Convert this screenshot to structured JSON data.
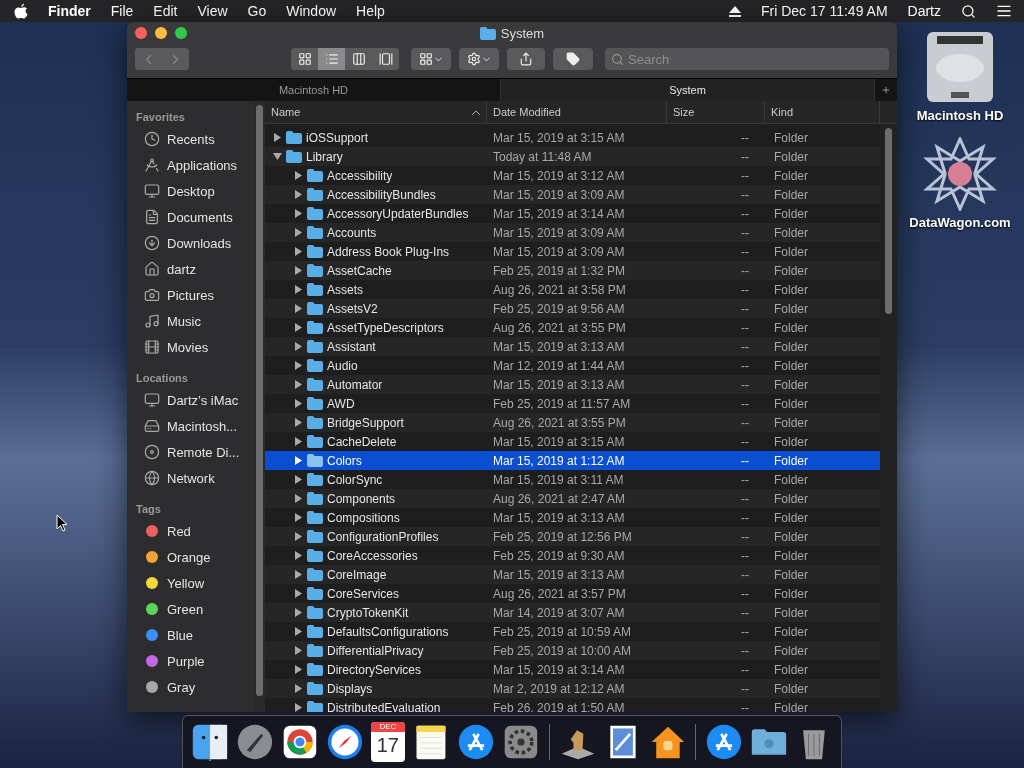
{
  "menu_bar": {
    "app": "Finder",
    "menus": [
      "File",
      "Edit",
      "View",
      "Go",
      "Window",
      "Help"
    ],
    "clock": "Fri Dec 17  11:49 AM",
    "user": "Dartz"
  },
  "window": {
    "title": "System",
    "search": {
      "placeholder": "Search"
    },
    "view_modes": [
      {
        "selected": false
      },
      {
        "selected": true
      },
      {
        "selected": false
      },
      {
        "selected": false
      }
    ],
    "tabs": [
      {
        "label": "Macintosh HD",
        "selected": false
      },
      {
        "label": "System",
        "selected": true
      }
    ],
    "sidebar": [
      {
        "heading": "Favorites",
        "items": [
          "Recents",
          "Applications",
          "Desktop",
          "Documents",
          "Downloads",
          "dartz",
          "Pictures",
          "Music",
          "Movies"
        ]
      },
      {
        "heading": "Locations",
        "items": [
          "Dartz’s iMac",
          "Macintosh...",
          "Remote Di...",
          "Network"
        ]
      },
      {
        "heading": "Tags",
        "tags": [
          {
            "label": "Red",
            "color": "#ec5f5e"
          },
          {
            "label": "Orange",
            "color": "#f6a33a"
          },
          {
            "label": "Yellow",
            "color": "#f4d83b"
          },
          {
            "label": "Green",
            "color": "#5dd55a"
          },
          {
            "label": "Blue",
            "color": "#3a8ef6"
          },
          {
            "label": "Purple",
            "color": "#c269e3"
          },
          {
            "label": "Gray",
            "color": "#a8a8a8"
          }
        ]
      }
    ],
    "table": {
      "columns": [
        "Name",
        "Date Modified",
        "Size",
        "Kind"
      ],
      "rows": [
        {
          "name": "iOSSupport",
          "date": "Mar 15, 2019 at 3:15 AM",
          "size": "--",
          "kind": "Folder",
          "expanded": false,
          "selected": false
        },
        {
          "name": "Library",
          "date": "Today at 11:48 AM",
          "size": "--",
          "kind": "Folder",
          "expanded": true,
          "selected": false,
          "children": [
            {
              "name": "Accessibility",
              "date": "Mar 15, 2019 at 3:12 AM",
              "size": "--",
              "kind": "Folder",
              "expanded": false,
              "selected": false
            },
            {
              "name": "AccessibilityBundles",
              "date": "Mar 15, 2019 at 3:09 AM",
              "size": "--",
              "kind": "Folder",
              "expanded": false,
              "selected": false
            },
            {
              "name": "AccessoryUpdaterBundles",
              "date": "Mar 15, 2019 at 3:14 AM",
              "size": "--",
              "kind": "Folder",
              "expanded": false,
              "selected": false
            },
            {
              "name": "Accounts",
              "date": "Mar 15, 2019 at 3:09 AM",
              "size": "--",
              "kind": "Folder",
              "expanded": false,
              "selected": false
            },
            {
              "name": "Address Book Plug-Ins",
              "date": "Mar 15, 2019 at 3:09 AM",
              "size": "--",
              "kind": "Folder",
              "expanded": false,
              "selected": false
            },
            {
              "name": "AssetCache",
              "date": "Feb 25, 2019 at 1:32 PM",
              "size": "--",
              "kind": "Folder",
              "expanded": false,
              "selected": false
            },
            {
              "name": "Assets",
              "date": "Aug 26, 2021 at 3:58 PM",
              "size": "--",
              "kind": "Folder",
              "expanded": false,
              "selected": false
            },
            {
              "name": "AssetsV2",
              "date": "Feb 25, 2019 at 9:56 AM",
              "size": "--",
              "kind": "Folder",
              "expanded": false,
              "selected": false
            },
            {
              "name": "AssetTypeDescriptors",
              "date": "Aug 26, 2021 at 3:55 PM",
              "size": "--",
              "kind": "Folder",
              "expanded": false,
              "selected": false
            },
            {
              "name": "Assistant",
              "date": "Mar 15, 2019 at 3:13 AM",
              "size": "--",
              "kind": "Folder",
              "expanded": false,
              "selected": false
            },
            {
              "name": "Audio",
              "date": "Mar 12, 2019 at 1:44 AM",
              "size": "--",
              "kind": "Folder",
              "expanded": false,
              "selected": false
            },
            {
              "name": "Automator",
              "date": "Mar 15, 2019 at 3:13 AM",
              "size": "--",
              "kind": "Folder",
              "expanded": false,
              "selected": false
            },
            {
              "name": "AWD",
              "date": "Feb 25, 2019 at 11:57 AM",
              "size": "--",
              "kind": "Folder",
              "expanded": false,
              "selected": false
            },
            {
              "name": "BridgeSupport",
              "date": "Aug 26, 2021 at 3:55 PM",
              "size": "--",
              "kind": "Folder",
              "expanded": false,
              "selected": false
            },
            {
              "name": "CacheDelete",
              "date": "Mar 15, 2019 at 3:15 AM",
              "size": "--",
              "kind": "Folder",
              "expanded": false,
              "selected": false
            },
            {
              "name": "Colors",
              "date": "Mar 15, 2019 at 1:12 AM",
              "size": "--",
              "kind": "Folder",
              "expanded": false,
              "selected": true
            },
            {
              "name": "ColorSync",
              "date": "Mar 15, 2019 at 3:11 AM",
              "size": "--",
              "kind": "Folder",
              "expanded": false,
              "selected": false
            },
            {
              "name": "Components",
              "date": "Aug 26, 2021 at 2:47 AM",
              "size": "--",
              "kind": "Folder",
              "expanded": false,
              "selected": false
            },
            {
              "name": "Compositions",
              "date": "Mar 15, 2019 at 3:13 AM",
              "size": "--",
              "kind": "Folder",
              "expanded": false,
              "selected": false
            },
            {
              "name": "ConfigurationProfiles",
              "date": "Feb 25, 2019 at 12:56 PM",
              "size": "--",
              "kind": "Folder",
              "expanded": false,
              "selected": false
            },
            {
              "name": "CoreAccessories",
              "date": "Feb 25, 2019 at 9:30 AM",
              "size": "--",
              "kind": "Folder",
              "expanded": false,
              "selected": false
            },
            {
              "name": "CoreImage",
              "date": "Mar 15, 2019 at 3:13 AM",
              "size": "--",
              "kind": "Folder",
              "expanded": false,
              "selected": false
            },
            {
              "name": "CoreServices",
              "date": "Aug 26, 2021 at 3:57 PM",
              "size": "--",
              "kind": "Folder",
              "expanded": false,
              "selected": false
            },
            {
              "name": "CryptoTokenKit",
              "date": "Mar 14, 2019 at 3:07 AM",
              "size": "--",
              "kind": "Folder",
              "expanded": false,
              "selected": false
            },
            {
              "name": "DefaultsConfigurations",
              "date": "Feb 25, 2019 at 10:59 AM",
              "size": "--",
              "kind": "Folder",
              "expanded": false,
              "selected": false
            },
            {
              "name": "DifferentialPrivacy",
              "date": "Feb 25, 2019 at 10:00 AM",
              "size": "--",
              "kind": "Folder",
              "expanded": false,
              "selected": false
            },
            {
              "name": "DirectoryServices",
              "date": "Mar 15, 2019 at 3:14 AM",
              "size": "--",
              "kind": "Folder",
              "expanded": false,
              "selected": false
            },
            {
              "name": "Displays",
              "date": "Mar 2, 2019 at 12:12 AM",
              "size": "--",
              "kind": "Folder",
              "expanded": false,
              "selected": false
            },
            {
              "name": "DistributedEvaluation",
              "date": "Feb 26, 2019 at 1:50 AM",
              "size": "--",
              "kind": "Folder",
              "expanded": false,
              "selected": false
            }
          ]
        }
      ]
    }
  },
  "desktop": {
    "icons": [
      "Macintosh HD",
      "DataWagon.com"
    ]
  },
  "dock": {
    "calendar_month": "DEC",
    "calendar_day": "17"
  }
}
